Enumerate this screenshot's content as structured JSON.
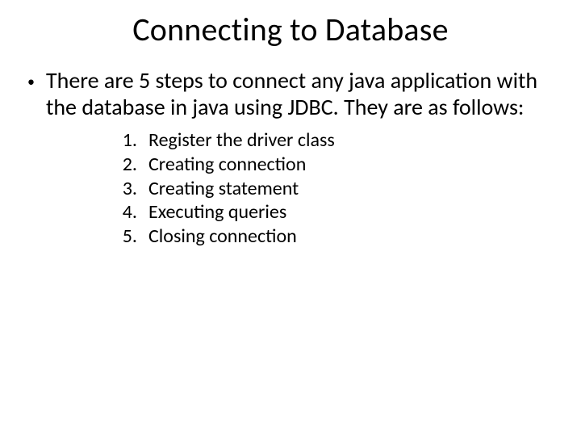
{
  "title": "Connecting to Database",
  "intro": "There are 5 steps to connect any java application with the database in java using JDBC. They are as follows:",
  "steps": [
    {
      "num": "1.",
      "text": "Register the driver class"
    },
    {
      "num": "2.",
      "text": "Creating connection"
    },
    {
      "num": "3.",
      "text": "Creating statement"
    },
    {
      "num": "4.",
      "text": "Executing queries"
    },
    {
      "num": "5.",
      "text": "Closing connection"
    }
  ]
}
